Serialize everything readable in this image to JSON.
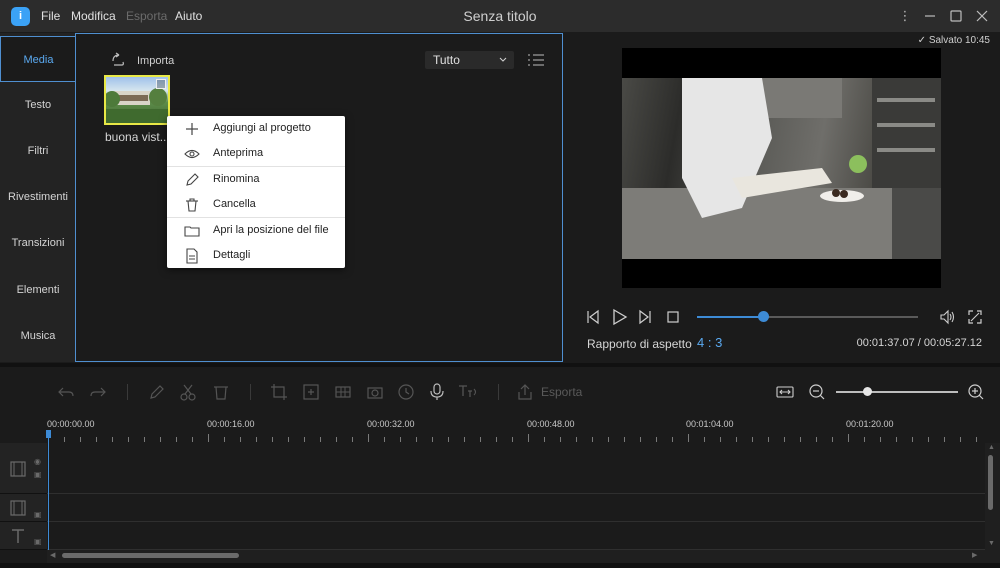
{
  "titlebar": {
    "logo": "i",
    "menu": [
      "File",
      "Modifica",
      "Esporta",
      "Aiuto"
    ],
    "title": "Senza titolo",
    "controls": [
      "more-icon",
      "minimize-icon",
      "maximize-icon",
      "close-icon"
    ]
  },
  "tabs": [
    "Media",
    "Testo",
    "Filtri",
    "Rivestimenti",
    "Transizioni",
    "Elementi",
    "Musica"
  ],
  "media": {
    "import_label": "Importa",
    "filter_value": "Tutto",
    "item_name": "buona vist..."
  },
  "context_menu": {
    "items": [
      "Aggiungi al progetto",
      "Anteprima",
      "Rinomina",
      "Cancella",
      "Apri la posizione del file",
      "Dettagli"
    ]
  },
  "preview": {
    "saved": "Salvato 10:45",
    "progress": 0.3,
    "aspect_label": "Rapporto di aspetto",
    "aspect_value": "4 : 3",
    "timecode": "00:01:37.07 / 00:05:27.12"
  },
  "toolbar": {
    "export_label": "Esporta",
    "zoom": 0.25
  },
  "timeline": {
    "ruler": [
      "00:00:00.00",
      "00:00:16.00",
      "00:00:32.00",
      "00:00:48.00",
      "00:01:04.00",
      "00:01:20.00"
    ]
  },
  "colors": {
    "accent": "#3d8bd6",
    "thumb_border": "#e8e846",
    "panel_border": "#4f8fd0"
  }
}
